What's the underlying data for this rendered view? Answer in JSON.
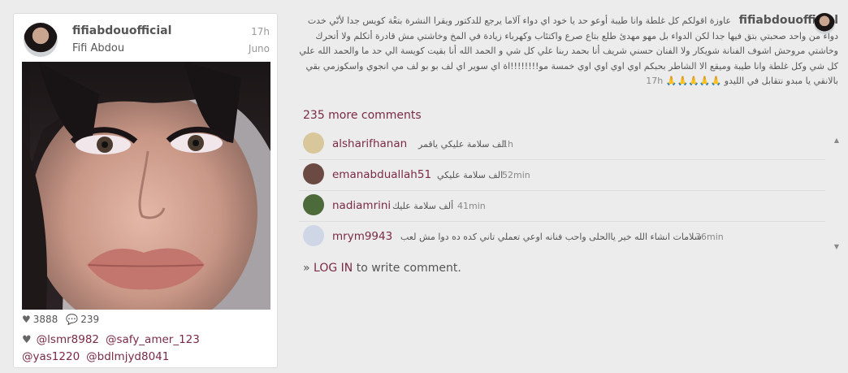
{
  "card": {
    "username": "fifiabdouofficial",
    "full_name": "Fifi Abdou",
    "time": "17h",
    "location": "Juno",
    "likes": "3888",
    "comments": "239",
    "likers": [
      "@lsmr8982",
      "@safy_amer_123",
      "@yas1220",
      "@bdlmjyd8041"
    ]
  },
  "post": {
    "author": "fifiabdouofficial",
    "caption": "عاوزة اقولكم كل غلطة وانا طيبة أوعو حد يا خود اي دواء آلاما يرجع للدكتور ويقرا النشرة بتعْة كويس جدا لأنّي خدت دواء من واحد صحبتي بتق فيها جدا لكن الدواء بل مهو مهدئ طلع بتاع صرع واكتئاب وكهرباء زيادة في المخ وخاشتي مش قادرة أتكلم ولا أتحرك وخاشتي مروحش اشوف الفنانة شويكار ولا الفنان حسني شريف أنا بحمد ربنا علي كل شي و الحمد الله أنا بقيت كويسة الي حد ما والحمد الله علي كل شي وكل غلطة وانا طيبة وميقع الا الشاطر بحبكم اوي اوي اوي اوي خمسة مو!!!!!!!!اة اي سوير اي لف بو بو لف مي انجوي واسكوزمي بقي بالانقي يا مبدو نتقابل في الليدو 🙏🙏🙏🙏🙏",
    "time": "17h",
    "more_comments": "235 more comments"
  },
  "comments": [
    {
      "user": "alsharifhanan",
      "text": "الف سلامة عليكي ياقمر",
      "time": "1h",
      "avatar_color": "#d8c79a"
    },
    {
      "user": "emanabduallah51",
      "text": "الف سلامة عليكي",
      "time": "52min",
      "avatar_color": "#6b4a43"
    },
    {
      "user": "nadiamrini",
      "text": "ألف سلامة عليك",
      "time": "41min",
      "avatar_color": "#4c6a3a"
    },
    {
      "user": "mrym9943",
      "text": "سلامات انشاء الله خير ياالحلى واحب فنانه اوعي تعملي تاني كده ده دوا مش لعب",
      "time": "36min",
      "avatar_color": "#cfd6e6"
    }
  ],
  "login": {
    "prefix": "» ",
    "link": "LOG IN",
    "suffix": " to write comment."
  },
  "icons": {
    "heart": "heart-icon",
    "chat": "chat-bubble-icon",
    "scroll_up": "scroll-up-arrow-icon",
    "scroll_down": "scroll-down-arrow-icon"
  },
  "colors": {
    "link": "#7a2b43",
    "background": "#ececec"
  }
}
